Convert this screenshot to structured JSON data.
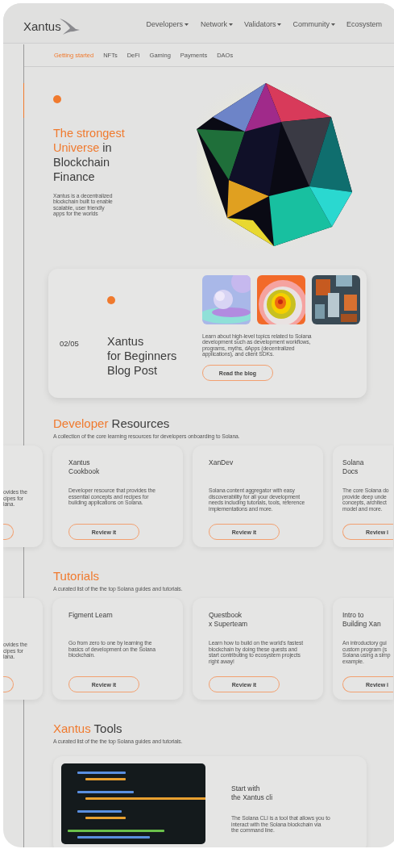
{
  "header": {
    "logo": "Xantus",
    "nav": [
      {
        "label": "Developers",
        "dropdown": true
      },
      {
        "label": "Network",
        "dropdown": true
      },
      {
        "label": "Validators",
        "dropdown": true
      },
      {
        "label": "Community",
        "dropdown": true
      },
      {
        "label": "Ecosystem",
        "dropdown": false
      }
    ]
  },
  "subnav": [
    {
      "label": "Getting started",
      "selected": true
    },
    {
      "label": "NFTs",
      "selected": false
    },
    {
      "label": "DeFi",
      "selected": false
    },
    {
      "label": "Gaming",
      "selected": false
    },
    {
      "label": "Payments",
      "selected": false
    },
    {
      "label": "DAOs",
      "selected": false
    }
  ],
  "hero": {
    "heading_accent": "The strongest Universe",
    "heading_rest": "in Blockchain Finance",
    "text": "Xantus is  a decentralized\nblockchain built to enable\nscalable, user friendly\napps for the worlds"
  },
  "blog": {
    "counter": "02/05",
    "title": "Xantus\nfor Beginners\nBlog Post",
    "text": "Learn about high-level topics related to Solana\ndevelopment such as development workflows,\nprograms, myths, dApps (decentralized\napplications), and client SDKs.",
    "button": "Read the blog"
  },
  "developer_resources": {
    "title_accent": "Developer",
    "title_rest": "Resources",
    "subtitle": "A collection of the core learning resources for developers onboarding to Solana.",
    "cards": [
      {
        "kind": "clipped_left",
        "text": "ovides the\ncipes for\nlana."
      },
      {
        "kind": "full",
        "title": "Xantus\nCookbook",
        "text": "Developer resource that provides the\nessential concepts and recipes for\nbuilding applications on Solana.",
        "button": "Review it"
      },
      {
        "kind": "full",
        "title": "XanDev",
        "text": "Solana content aggregator with easy\ndiscoverability for all your development\nneeds including tutorials, tools, reference\nimplementations and more.",
        "button": "Review it"
      },
      {
        "kind": "clipped_right",
        "title": "Solana\nDocs",
        "text": "The core Solana do\nprovide deep unde\nconcepts, architect\nmodel and more.",
        "button": "Review i"
      }
    ]
  },
  "tutorials": {
    "title_accent": "Tutorials",
    "subtitle": "A curated list of the the top Solana guides and tutorials.",
    "cards": [
      {
        "kind": "clipped_left",
        "text": "ovides the\ncipes for\nlana."
      },
      {
        "kind": "full",
        "title": "Figment Learn",
        "text": "Go from zero to one by learning the\nbasics of development on the Solana\nblockchain.",
        "button": "Review it"
      },
      {
        "kind": "full",
        "title": "Questbook\nx Superteam",
        "text": "Learn how to build on the world's fastest\nblockchain by doing these quests and\nstart contributing to ecosystem projects\nright away!",
        "button": "Review it"
      },
      {
        "kind": "clipped_right",
        "title": "Intro to\nBuilding Xan",
        "text": "An introductory gui\ncustom program (s\nSolana using a simp\nexample.",
        "button": "Review i"
      }
    ]
  },
  "tools": {
    "title_accent": "Xantus",
    "title_rest": "Tools",
    "subtitle": "A curated list of the the top Solana guides and tutorials.",
    "card": {
      "title": "Start with\nthe Xantus cli",
      "text": "The Solana CLI is a tool that allows you to\ninteract with the Solana blockchain via\nthe command line."
    }
  }
}
